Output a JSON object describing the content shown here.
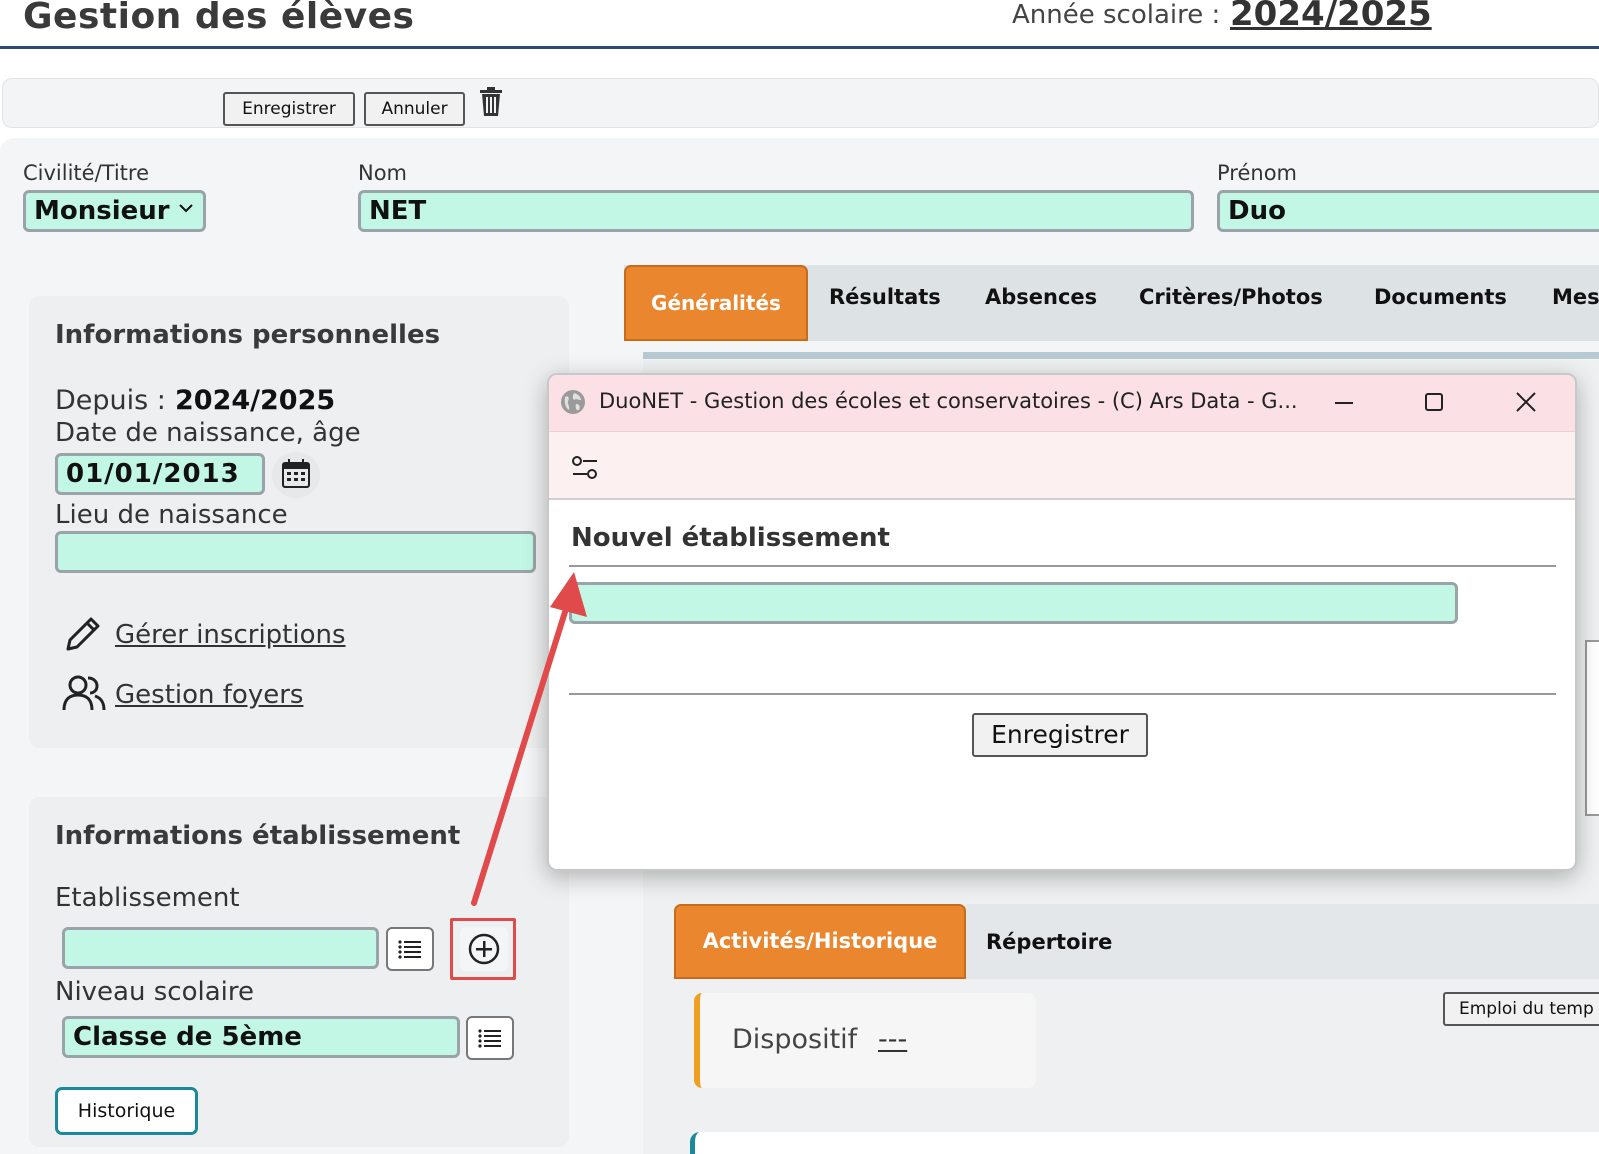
{
  "header": {
    "title": "Gestion des élèves",
    "year_label": "Année scolaire :",
    "year_value": "2024/2025"
  },
  "toolbar": {
    "save_label": "Enregistrer",
    "cancel_label": "Annuler",
    "delete_icon": "trash-icon"
  },
  "identity": {
    "civility_label": "Civilité/Titre",
    "civility_value": "Monsieur",
    "nom_label": "Nom",
    "nom_value": "NET",
    "prenom_label": "Prénom",
    "prenom_value": "Duo"
  },
  "personal": {
    "title": "Informations personnelles",
    "since_label": "Depuis :",
    "since_value": "2024/2025",
    "dob_label": "Date de naissance, âge",
    "dob_value": "01/01/2013",
    "birthplace_label": "Lieu de naissance",
    "birthplace_value": "",
    "manage_enrollments": "Gérer inscriptions",
    "manage_households": "Gestion foyers"
  },
  "school": {
    "title": "Informations établissement",
    "establishment_label": "Etablissement",
    "establishment_value": "",
    "level_label": "Niveau scolaire",
    "level_value": "Classe de 5ème",
    "history_button": "Historique"
  },
  "tabs": [
    {
      "label": "Généralités",
      "active": true
    },
    {
      "label": "Résultats"
    },
    {
      "label": "Absences"
    },
    {
      "label": "Critères/Photos"
    },
    {
      "label": "Documents"
    },
    {
      "label": "Mes"
    }
  ],
  "subtabs": [
    {
      "label": "Activités/Historique",
      "active": true
    },
    {
      "label": "Répertoire"
    }
  ],
  "activity": {
    "schedule_button": "Emploi du temp",
    "dispositif_label": "Dispositif",
    "dispositif_value": "---"
  },
  "dialog": {
    "window_title": "DuoNET - Gestion des écoles et conservatoires - (C) Ars Data - G...",
    "heading": "Nouvel établissement",
    "input_value": "",
    "save_label": "Enregistrer"
  },
  "colors": {
    "accent_orange": "#e9862e",
    "field_mint": "#c2f7e6",
    "header_rule": "#2f4a6d",
    "annotation_red": "#e04a4a",
    "dialog_titlebar": "#fbe1e5"
  }
}
